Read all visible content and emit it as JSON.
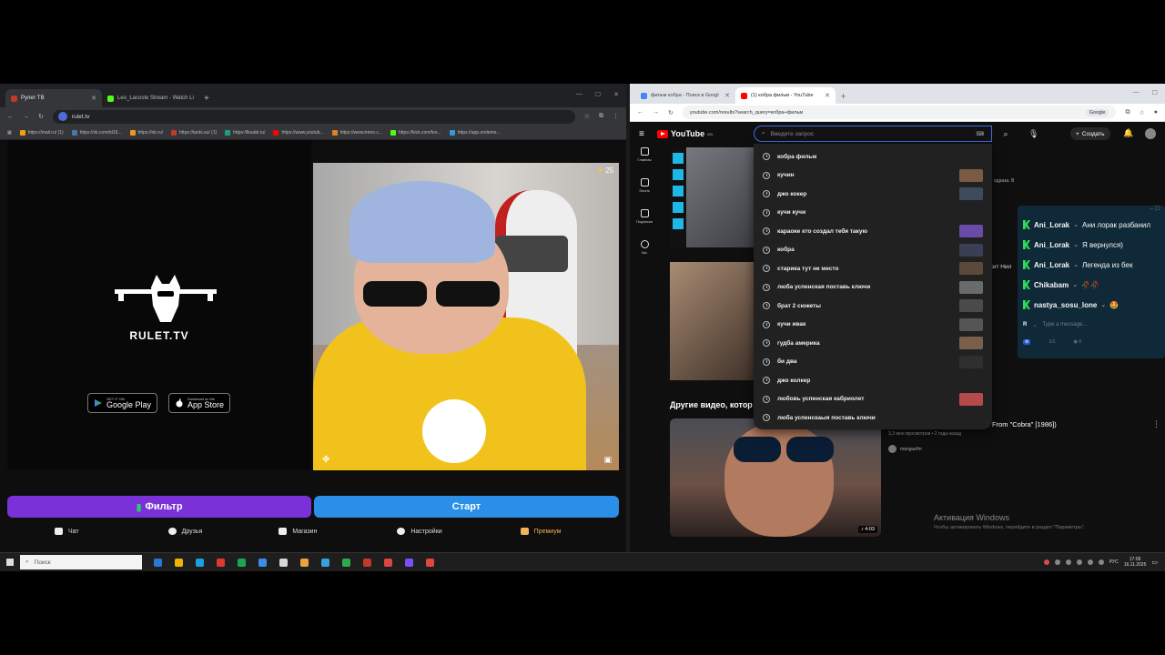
{
  "left_browser": {
    "tabs": [
      {
        "label": "Рулет ТВ",
        "color": "#c0392b",
        "active": true
      },
      {
        "label": "Leo_Lacoste Stream - Watch Li",
        "color": "#53fc18",
        "active": false
      }
    ],
    "url": "rulet.tv",
    "bookmarks": [
      {
        "label": "https://mail.ru/ (1)",
        "color": "#f39c12"
      },
      {
        "label": "https://vk.com/id19...",
        "color": "#4a76a8"
      },
      {
        "label": "https://ok.ru/",
        "color": "#f7931e"
      },
      {
        "label": "https://tanki.su/ (1)",
        "color": "#c0392b"
      },
      {
        "label": "https://lkoabl.ru/",
        "color": "#16a085"
      },
      {
        "label": "https://www.youtub...",
        "color": "#ff0000"
      },
      {
        "label": "https://www.treno.c...",
        "color": "#e67e22"
      },
      {
        "label": "https://kick.com/leo...",
        "color": "#53fc18"
      },
      {
        "label": "https://app.ondeme...",
        "color": "#3498db"
      }
    ],
    "page": {
      "brand": "RULET.TV",
      "google_play_small": "GET IT ON",
      "google_play_big": "Google Play",
      "app_store_small": "Download on the",
      "app_store_big": "App Store",
      "stars": "25",
      "filter_button": "Фильтр",
      "start_button": "Старт",
      "nav": [
        {
          "label": "Чат",
          "icon": "chat-icon"
        },
        {
          "label": "Друзья",
          "icon": "friends-icon"
        },
        {
          "label": "Магазин",
          "icon": "shop-icon"
        },
        {
          "label": "Настройки",
          "icon": "gear-icon"
        },
        {
          "label": "Премиум",
          "icon": "premium-icon"
        }
      ]
    }
  },
  "right_browser": {
    "tabs": [
      {
        "label": "фильм кобра - Поиск в Googl",
        "color": "#4285f4",
        "active": false
      },
      {
        "label": "(1) кобра фильм - YouTube",
        "color": "#ff0000",
        "active": true
      }
    ],
    "url": "youtube.com/results?search_query=кобра+фильм",
    "google_pill": "Google",
    "youtube": {
      "logo": "YouTube",
      "region": "MD",
      "search_placeholder": "Введите запрос",
      "create_label": "Создать",
      "rail": [
        "Главная",
        "Shorts",
        "Подписки",
        "Вы"
      ],
      "suggestions": [
        {
          "text": "кобра фильм",
          "thumb": ""
        },
        {
          "text": "кучин",
          "thumb": "#7a5a43"
        },
        {
          "text": "джо кокер",
          "thumb": "#3d4b5c"
        },
        {
          "text": "кучи кучи",
          "thumb": ""
        },
        {
          "text": "караоке кто создал тебя такую",
          "thumb": "#6a4ba8"
        },
        {
          "text": "кобра",
          "thumb": "#3a3f55"
        },
        {
          "text": "старика тут не место",
          "thumb": "#5b4a3a"
        },
        {
          "text": "люба успенская поставь ключи",
          "thumb": "#6a6a6a"
        },
        {
          "text": "брат 2 сюжеты",
          "thumb": "#4b4b4b"
        },
        {
          "text": "кучи ивак",
          "thumb": "#555"
        },
        {
          "text": "гудба америка",
          "thumb": "#7a5f4a"
        },
        {
          "text": "би два",
          "thumb": "#2f2f2f"
        },
        {
          "text": "джо колкер",
          "thumb": ""
        },
        {
          "text": "любовь успенская кабриолет",
          "thumb": "#b44a4a"
        },
        {
          "text": "люба успенскаыя поставь ключи",
          "thumb": ""
        }
      ],
      "side_text_1": "одраза. В",
      "side_text_2": "кит Нил",
      "other_videos": "Другие видео, котор",
      "video_title": "From \"Cobra\" [1986])",
      "views": "3,3 млн просмотров • 2 года назад",
      "channel": "manguefm",
      "duration": "4:03"
    },
    "chat": {
      "messages": [
        {
          "user": "Ani_Lorak",
          "text": "Ани лорак разбанил"
        },
        {
          "user": "Ani_Lorak",
          "text": "Я вернулся)"
        },
        {
          "user": "Ani_Lorak",
          "text": "Легенда из бек"
        },
        {
          "user": "Chikabam",
          "text": "🥀🥀"
        },
        {
          "user": "nastya_sosu_lone",
          "text": "🤩"
        }
      ],
      "input_placeholder": "Type a message...",
      "counter": "1/1",
      "viewers": "0"
    },
    "activation_title": "Активация Windows",
    "activation_text": "Чтобы активировать Windows, перейдите в раздел \"Параметры\"."
  },
  "taskbar": {
    "search_placeholder": "Поиск",
    "lang": "РУС",
    "time": "17:09",
    "date": "16.11.2025",
    "apps": [
      "#2b79d6",
      "#f0b400",
      "#1aa1e0",
      "#e03a2f",
      "#1aa84f",
      "#3a8ee6",
      "#d8d8d8",
      "#e8a43a",
      "#37a0e0",
      "#2ea84d",
      "#c0392b",
      "#d44",
      "#7c4dff",
      "#e0483e"
    ]
  }
}
